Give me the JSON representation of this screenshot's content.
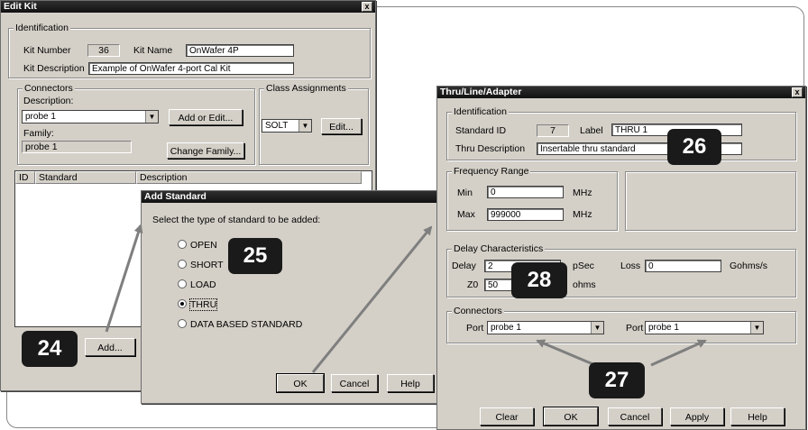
{
  "edit_kit": {
    "title": "Edit Kit",
    "close": "x",
    "identification": "Identification",
    "kit_number_label": "Kit Number",
    "kit_number": "36",
    "kit_name_label": "Kit Name",
    "kit_name": "OnWafer 4P",
    "kit_desc_label": "Kit Description",
    "kit_desc": "Example of OnWafer 4-port Cal Kit",
    "connectors": "Connectors",
    "description_label": "Description:",
    "description_value": "probe 1",
    "add_or_edit": "Add or Edit...",
    "family_label": "Family:",
    "family_value": "probe 1",
    "change_family": "Change Family...",
    "class_assignments": "Class Assignments",
    "class_value": "SOLT",
    "edit": "Edit...",
    "col_id": "ID",
    "col_standard": "Standard",
    "col_description": "Description",
    "add": "Add..."
  },
  "add_standard": {
    "title": "Add Standard",
    "prompt": "Select the type of standard to be added:",
    "options": [
      "OPEN",
      "SHORT",
      "LOAD",
      "THRU",
      "DATA BASED STANDARD"
    ],
    "selected": "THRU",
    "ok": "OK",
    "cancel": "Cancel",
    "help": "Help"
  },
  "thru": {
    "title": "Thru/Line/Adapter",
    "close": "x",
    "identification": "Identification",
    "standard_id_label": "Standard ID",
    "standard_id": "7",
    "label_label": "Label",
    "label_value": "THRU 1",
    "thru_desc_label": "Thru Description",
    "thru_desc": "Insertable thru standard",
    "freq_range": "Frequency Range",
    "min_label": "Min",
    "min_value": "0",
    "max_label": "Max",
    "max_value": "999000",
    "mhz": "MHz",
    "delay_chars": "Delay Characteristics",
    "delay_label": "Delay",
    "delay_value": "2",
    "psec": "pSec",
    "loss_label": "Loss",
    "loss_value": "0",
    "gohms": "Gohms/s",
    "z0_label": "Z0",
    "z0_value": "50",
    "ohms": "ohms",
    "connectors": "Connectors",
    "port_label": "Port",
    "port1": "probe 1",
    "port2": "probe 1",
    "clear": "Clear",
    "ok": "OK",
    "cancel": "Cancel",
    "apply": "Apply",
    "help": "Help"
  },
  "callouts": [
    "24",
    "25",
    "26",
    "27",
    "28"
  ]
}
